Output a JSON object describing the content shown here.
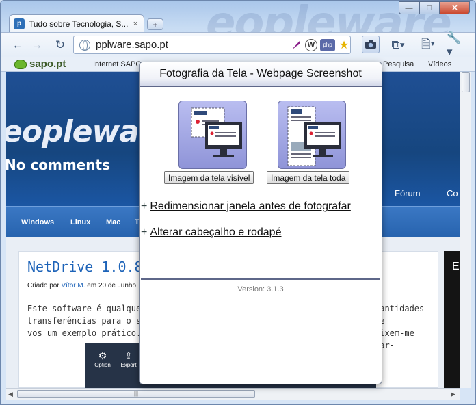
{
  "window": {
    "controls": {
      "minimize": "—",
      "maximize": "□",
      "close": "✕"
    }
  },
  "tab": {
    "title": "Tudo sobre Tecnologia, S...",
    "close": "×",
    "new_tab": "+"
  },
  "toolbar": {
    "url": "pplware.sapo.pt",
    "extensions": [
      "feather-icon",
      "wordpress-icon",
      "php-icon",
      "star-icon"
    ],
    "php_label": "php"
  },
  "bookmarks": {
    "logo": "sapo.pt",
    "items": [
      "Internet SAPO",
      "Pesquisa",
      "Vídeos"
    ]
  },
  "page": {
    "logo": "eopleware",
    "subtitle": "No comments",
    "top_nav": [
      "Fórum",
      "Co"
    ],
    "menu": [
      "Windows",
      "Linux",
      "Mac",
      "T"
    ],
    "article": {
      "title": "NetDrive 1.0.8.16 -",
      "meta_prefix": "Criado por",
      "author": "Vítor M.",
      "meta_date": "em 20 de Junho",
      "text_left_1": "Este software é qualquer co",
      "text_left_2": "transferências para o servido",
      "text_left_3": "vos um exemplo prático.",
      "text_right_1": "uantidades de",
      "text_right_2": "eixem-me dar-",
      "image_tools": [
        "Option",
        "Export"
      ]
    },
    "side_letter": "E"
  },
  "popup": {
    "title": "Fotografia da Tela - Webpage Screenshot",
    "btn_visible": "Imagem da tela visível",
    "btn_full": "Imagem da tela toda",
    "options": [
      {
        "plus": "+",
        "label": "Redimensionar janela antes de fotografar"
      },
      {
        "plus": "+",
        "label": "Alterar cabeçalho e rodapé"
      }
    ],
    "version": "Version: 3.1.3"
  },
  "colors": {
    "page_blue": "#1f4f94",
    "link_blue": "#1d63b8",
    "popup_accent": "#5e6789"
  }
}
